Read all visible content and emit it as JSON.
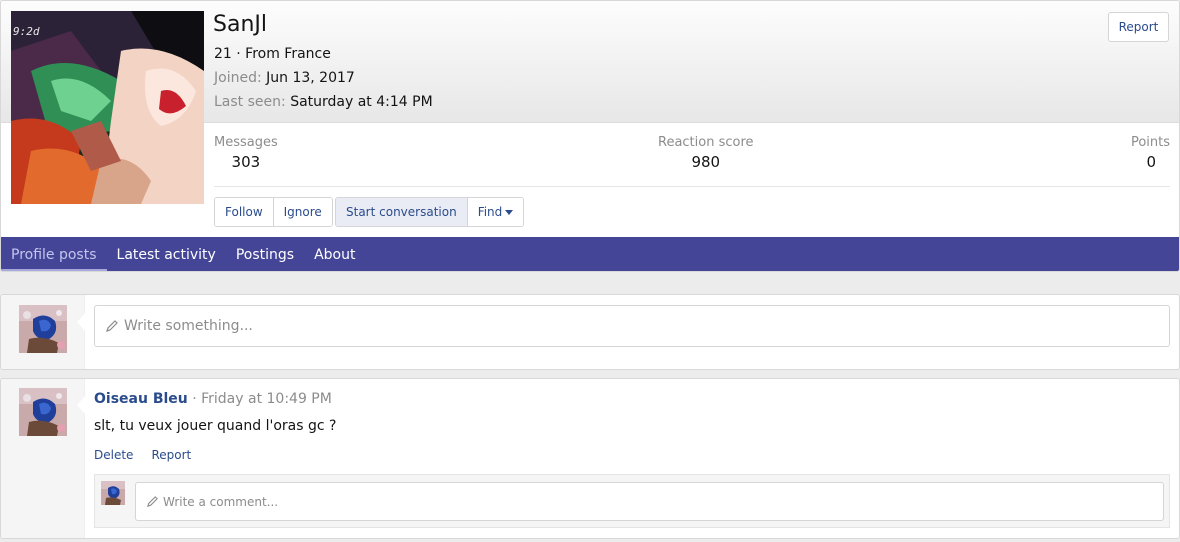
{
  "profile": {
    "username": "SanJl",
    "age_location": "21 · From France",
    "joined_label": "Joined:",
    "joined_value": "Jun 13, 2017",
    "last_seen_label": "Last seen:",
    "last_seen_value": "Saturday at 4:14 PM",
    "report_label": "Report",
    "avatar_overlay_text": "9:2d",
    "stats": {
      "messages_label": "Messages",
      "messages_value": "303",
      "reaction_label": "Reaction score",
      "reaction_value": "980",
      "points_label": "Points",
      "points_value": "0"
    },
    "buttons": {
      "follow": "Follow",
      "ignore": "Ignore",
      "start_conversation": "Start conversation",
      "find": "Find"
    }
  },
  "tabs": [
    {
      "label": "Profile posts",
      "active": true
    },
    {
      "label": "Latest activity",
      "active": false
    },
    {
      "label": "Postings",
      "active": false
    },
    {
      "label": "About",
      "active": false
    }
  ],
  "composer": {
    "placeholder": "Write something..."
  },
  "post": {
    "author": "Oiseau Bleu",
    "separator": " · ",
    "time": "Friday at 10:49 PM",
    "body": "slt, tu veux jouer quand l'oras gc ?",
    "actions": {
      "delete": "Delete",
      "report": "Report"
    },
    "comment_placeholder": "Write a comment..."
  },
  "colors": {
    "nav_bar": "#444596",
    "link": "#2b4c8c",
    "muted": "#8c8c8c"
  },
  "icons": {
    "pencil": "pencil-icon",
    "caret": "caret-down-icon"
  }
}
